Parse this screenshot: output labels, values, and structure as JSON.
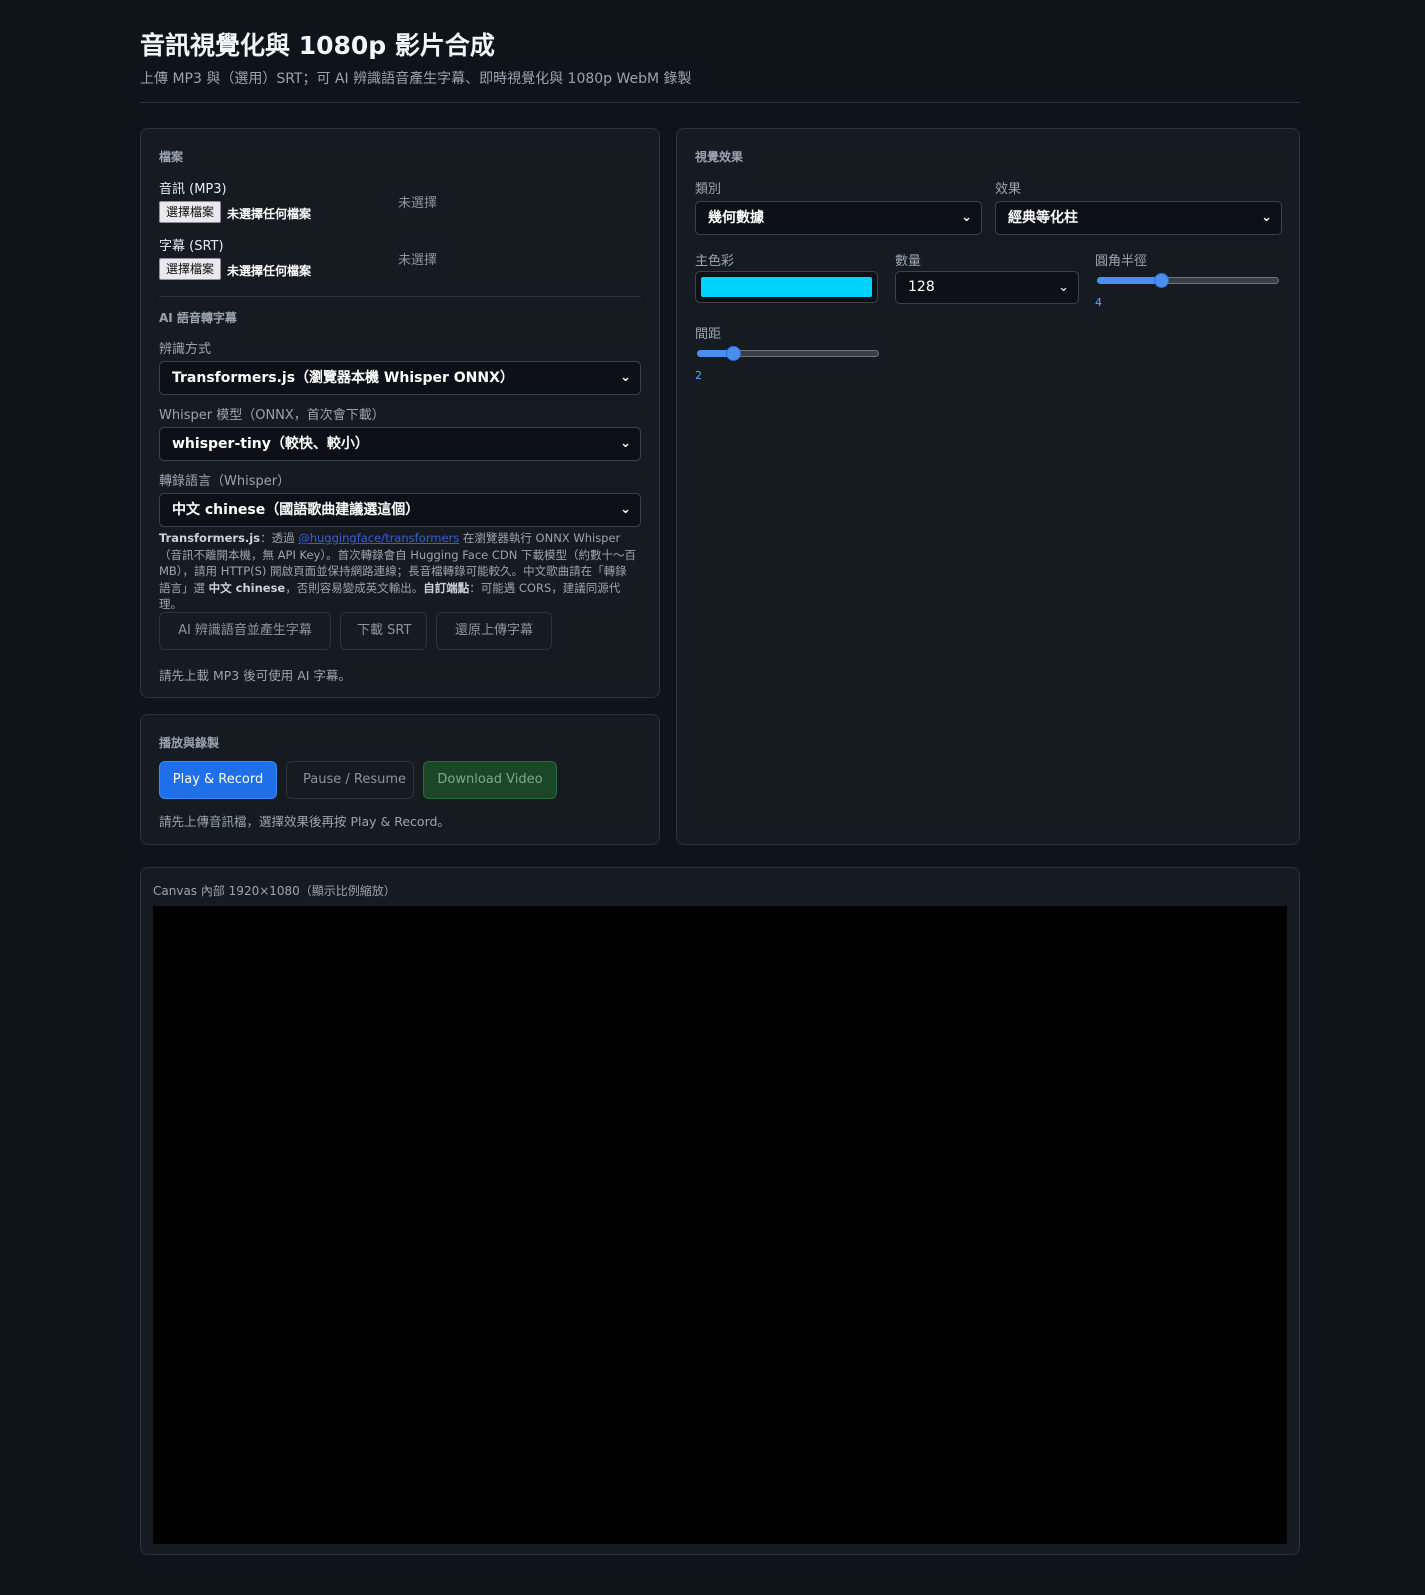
{
  "header": {
    "title": "音訊視覺化與 1080p 影片合成",
    "subtitle": "上傳 MP3 與（選用）SRT；可 AI 辨識語音產生字幕、即時視覺化與 1080p WebM 錄製"
  },
  "files": {
    "section_title": "檔案",
    "audio": {
      "label": "音訊 (MP3)",
      "button": "選擇檔案",
      "none": "未選擇任何檔案",
      "status": "未選擇"
    },
    "subtitle": {
      "label": "字幕 (SRT)",
      "button": "選擇檔案",
      "none": "未選擇任何檔案",
      "status": "未選擇"
    }
  },
  "ai": {
    "section_title": "AI 語音轉字幕",
    "method_label": "辨識方式",
    "method_value": "Transformers.js（瀏覽器本機 Whisper ONNX）",
    "model_label": "Whisper 模型（ONNX，首次會下載）",
    "model_value": "whisper-tiny（較快、較小）",
    "language_label": "轉錄語言（Whisper）",
    "language_value": "中文 chinese（國語歌曲建議選這個）",
    "note": {
      "p1_bold": "Transformers.js",
      "p2": "：透過 ",
      "p3_link": "@huggingface/transformers",
      "p4": " 在瀏覽器執行 ONNX Whisper（音訊不離開本機，無 API Key）。首次轉錄會自 Hugging Face CDN 下載模型（約數十～百 MB），請用 HTTP(S) 開啟頁面並保持網路連線；長音檔轉錄可能較久。中文歌曲請在「轉錄語言」選 ",
      "p5_bold": "中文 chinese",
      "p6": "，否則容易變成英文輸出。",
      "p7_bold": "自訂端點",
      "p8": "：可能遇 CORS，建議同源代理。"
    },
    "buttons": {
      "transcribe": "AI 辨識語音並產生字幕",
      "download_srt": "下載 SRT",
      "restore": "還原上傳字幕"
    },
    "hint": "請先上載 MP3 後可使用 AI 字幕。"
  },
  "playback": {
    "section_title": "播放與錄製",
    "play": "Play & Record",
    "pause": "Pause / Resume",
    "download": "Download Video",
    "hint": "請先上傳音訊檔，選擇效果後再按 Play & Record。"
  },
  "visual": {
    "section_title": "視覺效果",
    "category_label": "類別",
    "category_value": "幾何數據",
    "effect_label": "效果",
    "effect_value": "經典等化柱",
    "color_label": "主色彩",
    "color_value": "#00d2ff",
    "count_label": "數量",
    "count_value": "128",
    "radius_label": "圓角半徑",
    "radius_value": "4",
    "radius_fraction": 0.35,
    "gap_label": "間距",
    "gap_value": "2",
    "gap_fraction": 0.2
  },
  "canvas": {
    "caption": "Canvas 內部 1920×1080（顯示比例縮放）"
  },
  "colors": {
    "accent": "#1f6feb",
    "background": "#0f141b",
    "panel": "#161b22"
  }
}
